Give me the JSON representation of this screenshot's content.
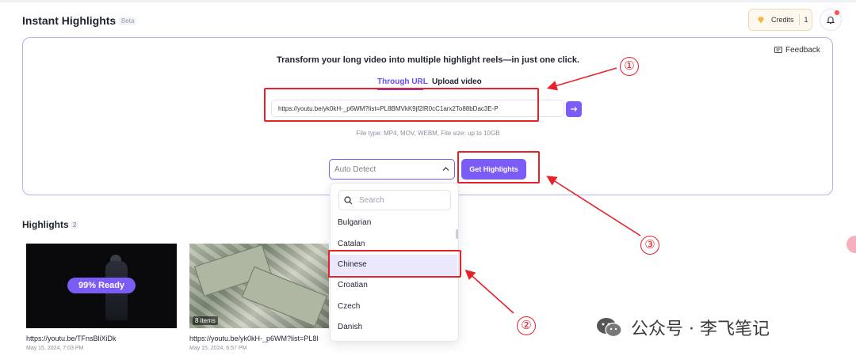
{
  "header": {
    "title": "Instant Highlights",
    "beta": "Beta",
    "credits_label": "Credits",
    "credits_value": "1"
  },
  "card": {
    "feedback": "Feedback",
    "headline": "Transform your long video into multiple highlight reels—in just one click.",
    "tabs": [
      "Through URL",
      "Upload video"
    ],
    "url_value": "https://youtu.be/yk0kH-_p6WM?list=PL8BMVkK9jf2lR0cC1arx2To88bDac3E-P",
    "file_types": "File type: MP4, MOV, WEBM, File size: up to 10GB",
    "language_placeholder": "Auto Detect",
    "submit_label": "Get Highlights"
  },
  "dropdown": {
    "search_placeholder": "Search",
    "options": [
      "Bulgarian",
      "Catalan",
      "Chinese",
      "Croatian",
      "Czech",
      "Danish"
    ],
    "selected": "Chinese"
  },
  "highlights": {
    "title": "Highlights",
    "count": "2",
    "items": [
      {
        "ready": "99% Ready",
        "url": "https://youtu.be/TFnsBliXiDk",
        "date": "May 15, 2024, 7:03 PM"
      },
      {
        "badge": "8 items",
        "url": "https://youtu.be/yk0kH-_p6WM?list=PL8l",
        "date": "May 15, 2024, 6:57 PM"
      }
    ]
  },
  "annotations": {
    "one": "①",
    "two": "②",
    "three": "③"
  },
  "watermark": "公众号 · 李飞笔记",
  "colors": {
    "accent": "#7b5cf6",
    "annotation": "#e8202a"
  }
}
